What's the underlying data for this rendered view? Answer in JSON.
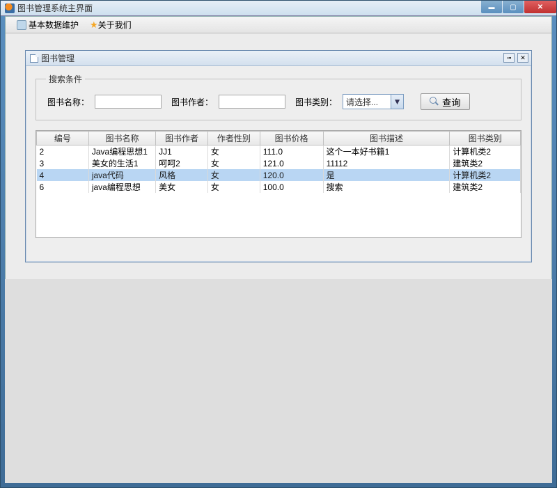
{
  "window": {
    "title": "图书管理系统主界面"
  },
  "menu": {
    "maintain": "基本数据维护",
    "about": "关于我们"
  },
  "internal_frame": {
    "title": "图书管理"
  },
  "search": {
    "legend": "搜索条件",
    "name_label": "图书名称：",
    "author_label": "图书作者：",
    "category_label": "图书类别：",
    "name_value": "",
    "author_value": "",
    "category_value": "请选择...",
    "query_button": "查询"
  },
  "table": {
    "headers": {
      "id": "编号",
      "name": "图书名称",
      "author": "图书作者",
      "gender": "作者性别",
      "price": "图书价格",
      "desc": "图书描述",
      "category": "图书类别"
    },
    "rows": [
      {
        "id": "2",
        "name": "Java编程思想1",
        "author": "JJ1",
        "gender": "女",
        "price": "111.0",
        "desc": "这个一本好书籍1",
        "category": "计算机类2"
      },
      {
        "id": "3",
        "name": "美女的生活1",
        "author": "呵呵2",
        "gender": "女",
        "price": "121.0",
        "desc": "11112",
        "category": "建筑类2"
      },
      {
        "id": "4",
        "name": "java代码",
        "author": "风格",
        "gender": "女",
        "price": "120.0",
        "desc": "是",
        "category": "计算机类2",
        "selected": true
      },
      {
        "id": "6",
        "name": "java编程思想",
        "author": "美女",
        "gender": "女",
        "price": "100.0",
        "desc": "搜索",
        "category": "建筑类2"
      }
    ]
  },
  "colwidths": {
    "id": 70,
    "name": 90,
    "author": 70,
    "gender": 70,
    "price": 85,
    "desc": 170,
    "category": 95
  }
}
